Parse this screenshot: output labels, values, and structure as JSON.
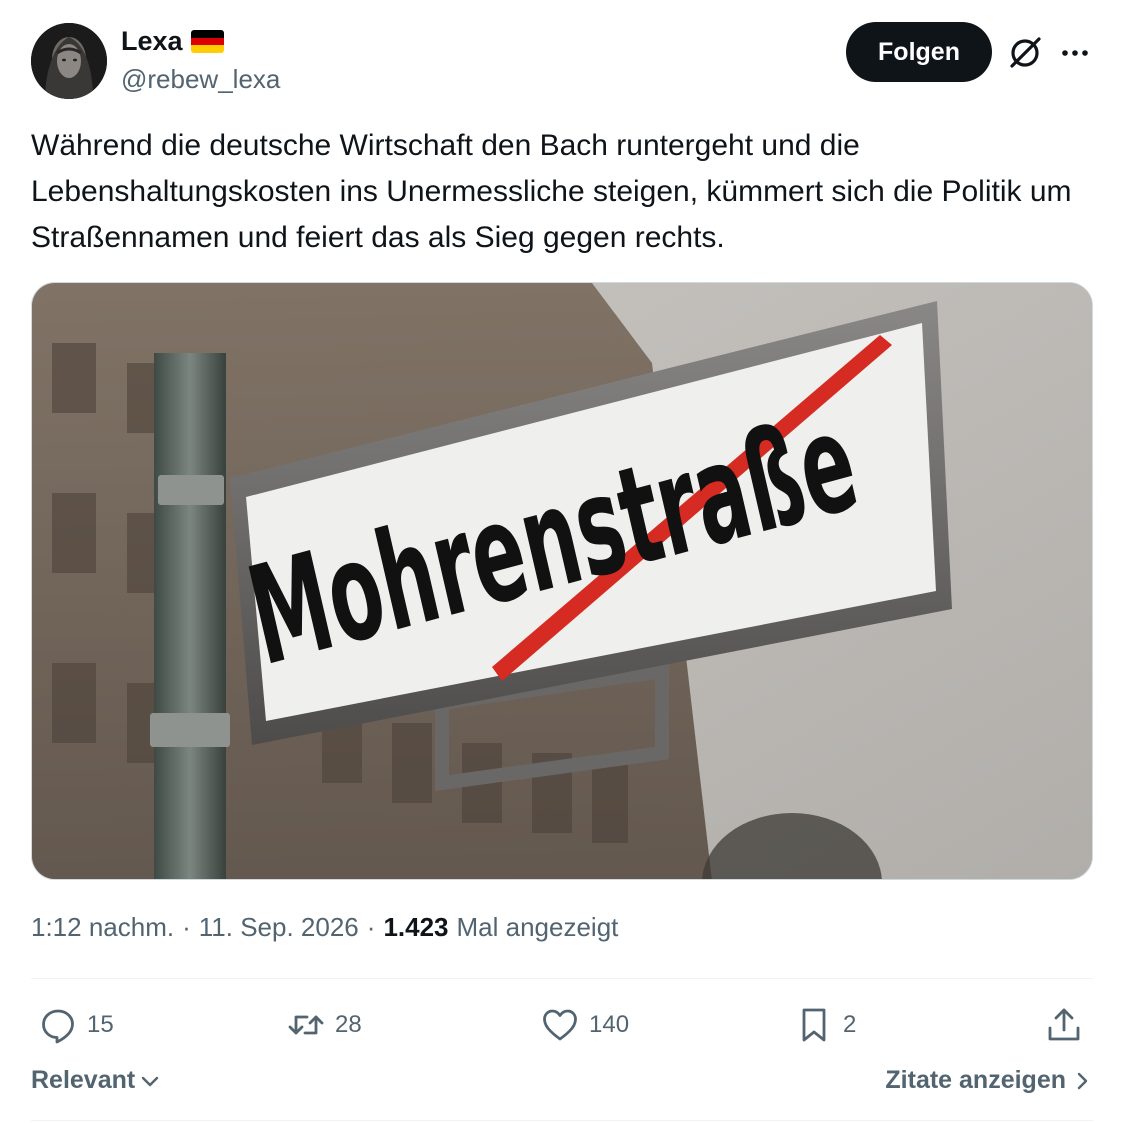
{
  "author": {
    "display_name": "Lexa",
    "handle": "@rebew_lexa",
    "flag_icon": "german-flag-icon",
    "flag_colors": [
      "#000000",
      "#dd0000",
      "#ffce00"
    ]
  },
  "header": {
    "follow_label": "Folgen",
    "grok_icon": "grok-icon",
    "more_icon": "more-icon"
  },
  "tweet": {
    "text": "Während die deutsche Wirtschaft den Bach runtergeht und die Lebenshaltungskosten ins Unermessliche steigen, kümmert sich die Politik um Straßennamen und feiert das als Sieg gegen rechts.",
    "image": {
      "sign_text": "Mohrenstraße",
      "description_icon": "street-sign-image"
    }
  },
  "meta": {
    "time": "1:12 nachm.",
    "separator1": "·",
    "date": "11. Sep. 2026",
    "separator2": "·",
    "views_count": "1.423",
    "views_label": "Mal angezeigt"
  },
  "actions": {
    "reply_count": "15",
    "retweet_count": "28",
    "like_count": "140",
    "bookmark_count": "2"
  },
  "footer": {
    "sort_label": "Relevant",
    "quotes_label": "Zitate anzeigen"
  },
  "colors": {
    "text_primary": "#0f1419",
    "text_secondary": "#536471",
    "divider": "#eff3f4",
    "strike_red": "#d62b22"
  }
}
